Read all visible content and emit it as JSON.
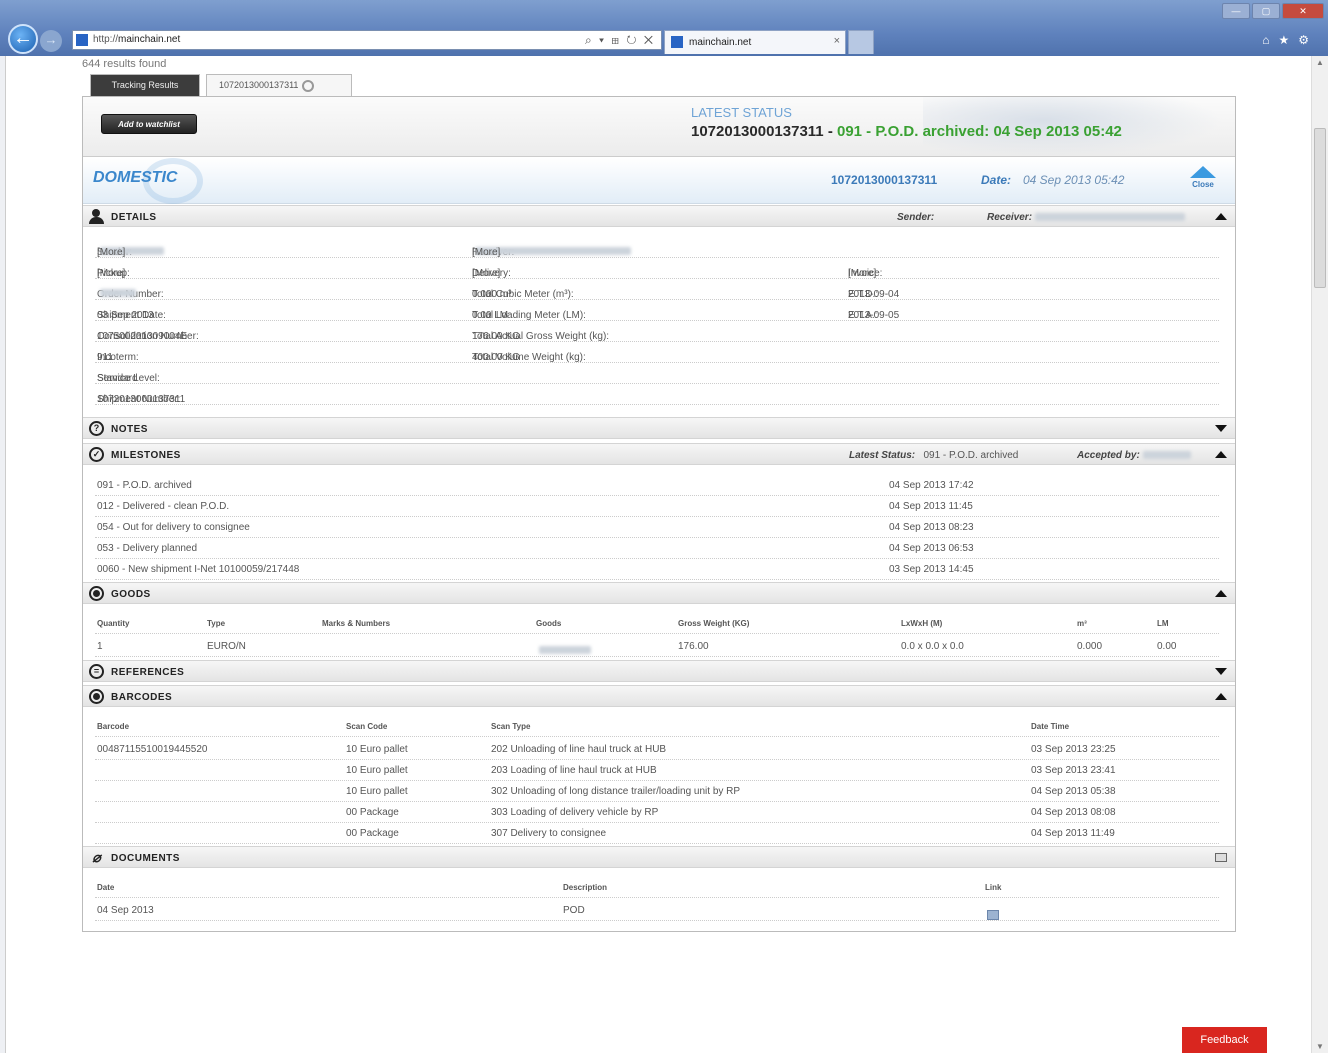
{
  "browser": {
    "url_prefix": "http://",
    "url_domain": "mainchain.net",
    "url_tools": "⌕ ▾ ⊞ ↻ ✕",
    "tab_label": "mainchain.net",
    "tab_close": "×"
  },
  "results_count": "644 results found",
  "tabs": [
    {
      "label": "Tracking Results"
    },
    {
      "label": "1072013000137311"
    }
  ],
  "header": {
    "watchlist_button": "Add to watchlist",
    "latest_status_label": "LATEST STATUS",
    "tracking_number": "1072013000137311 -",
    "status_text": "091 - P.O.D. archived: 04 Sep 2013 05:42"
  },
  "domestic": {
    "label": "DOMESTIC",
    "tracking_number": "1072013000137311",
    "date_label": "Date:",
    "date_value": "04 Sep 2013 05:42",
    "close_label": "Close"
  },
  "details": {
    "title": "DETAILS",
    "sender_label": "Sender:",
    "receiver_label": "Receiver:",
    "col1": [
      {
        "label": "Sender:",
        "value": "[More]"
      },
      {
        "label": "Pickup:",
        "value": "[More]"
      },
      {
        "label": "Order Number:",
        "value": ""
      },
      {
        "label": "Shipment Date:",
        "value": "03 Sep 2013"
      },
      {
        "label": "Consolidation Number:",
        "value": "107500201309004E"
      },
      {
        "label": "Incoterm:",
        "value": "911"
      },
      {
        "label": "Service Level:",
        "value": "Standard"
      },
      {
        "label": "Shipment Number:",
        "value": "1072013000137311"
      }
    ],
    "col2": [
      {
        "label": "Receiver:",
        "value": "[More]"
      },
      {
        "label": "Delivery:",
        "value": "[More]"
      },
      {
        "label": "Total Cubic Meter (m³):",
        "value": "0.000  m³"
      },
      {
        "label": "Total Loading Meter (LM):",
        "value": "0.00  LM"
      },
      {
        "label": "Total Actual Gross Weight (kg):",
        "value": "176.00  KG"
      },
      {
        "label": "Total Volume Weight (kg):",
        "value": "400.00  KG"
      }
    ],
    "col3": [
      {
        "label": "Invoice:",
        "value": "[More]"
      },
      {
        "label": "E.T.D.:",
        "value": "2013-09-04"
      },
      {
        "label": "E.T.A.:",
        "value": "2013-09-05"
      }
    ]
  },
  "notes": {
    "title": "NOTES"
  },
  "milestones": {
    "title": "MILESTONES",
    "latest_status_label": "Latest Status:",
    "latest_status_value": "091 - P.O.D. archived",
    "accepted_by_label": "Accepted by:",
    "items": [
      {
        "event": "091 - P.O.D. archived",
        "time": "04 Sep 2013 17:42"
      },
      {
        "event": "012 - Delivered - clean P.O.D.",
        "time": "04 Sep 2013 11:45"
      },
      {
        "event": "054 - Out for delivery to consignee",
        "time": "04 Sep 2013 08:23"
      },
      {
        "event": "053 - Delivery planned",
        "time": "04 Sep 2013 06:53"
      },
      {
        "event": "0060 - New shipment I-Net 10100059/217448",
        "time": "03 Sep 2013 14:45"
      }
    ]
  },
  "goods": {
    "title": "GOODS",
    "headers": [
      "Quantity",
      "Type",
      "Marks & Numbers",
      "Goods",
      "Gross Weight (KG)",
      "LxWxH (M)",
      "m³",
      "LM"
    ],
    "rows": [
      [
        "1",
        "EURO/N",
        "",
        "",
        "176.00",
        "0.0 x 0.0 x 0.0",
        "0.000",
        "0.00"
      ]
    ]
  },
  "references": {
    "title": "REFERENCES"
  },
  "barcodes": {
    "title": "BARCODES",
    "headers": [
      "Barcode",
      "Scan Code",
      "Scan Type",
      "Date Time"
    ],
    "rows": [
      [
        "00487115510019445520",
        "10 Euro pallet",
        "202 Unloading of line haul truck at HUB",
        "03 Sep 2013 23:25"
      ],
      [
        "",
        "10 Euro pallet",
        "203 Loading of line haul truck at HUB",
        "03 Sep 2013 23:41"
      ],
      [
        "",
        "10 Euro pallet",
        "302 Unloading of long distance trailer/loading unit by RP",
        "04 Sep 2013 05:38"
      ],
      [
        "",
        "00 Package",
        "303 Loading of delivery vehicle by RP",
        "04 Sep 2013 08:08"
      ],
      [
        "",
        "00 Package",
        "307 Delivery to consignee",
        "04 Sep 2013 11:49"
      ]
    ]
  },
  "documents": {
    "title": "DOCUMENTS",
    "headers": [
      "Date",
      "Description",
      "Link"
    ],
    "rows": [
      [
        "04 Sep 2013",
        "POD",
        ""
      ]
    ]
  },
  "feedback": "Feedback",
  "colors": {
    "accent": "#3b87cc",
    "status_green": "#3aa132",
    "feedback_red": "#d9261f"
  }
}
